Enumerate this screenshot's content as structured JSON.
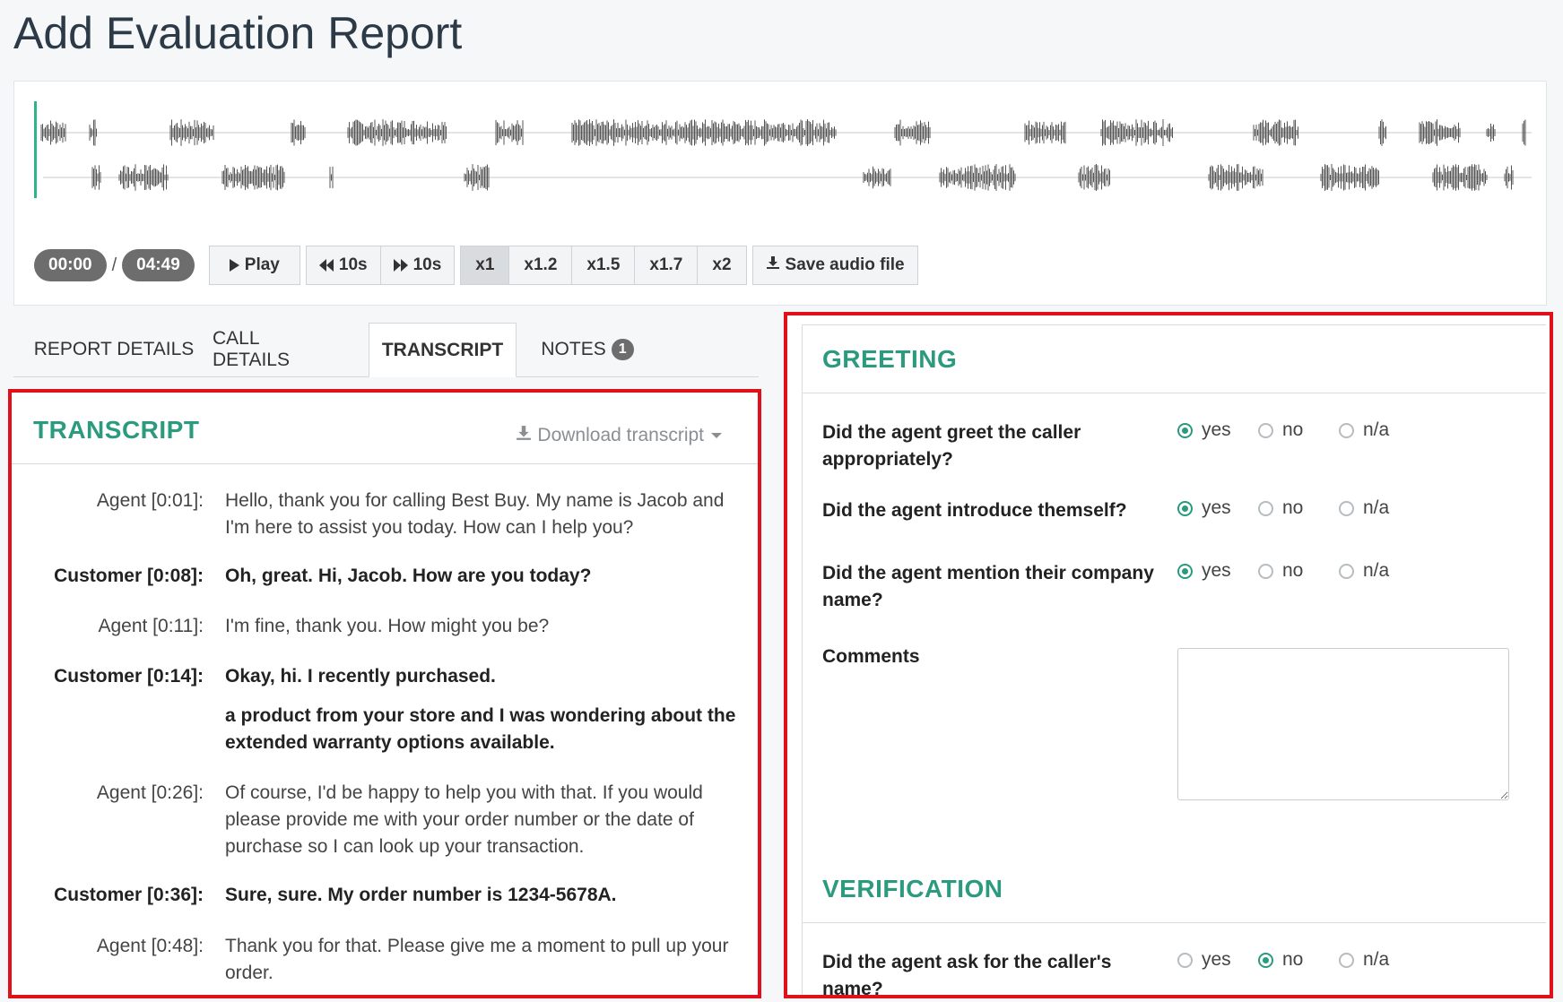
{
  "page": {
    "title": "Add Evaluation Report"
  },
  "player": {
    "current_time": "00:00",
    "time_separator": "/",
    "duration": "04:49",
    "play_label": "Play",
    "rewind_label": "10s",
    "forward_label": "10s",
    "speeds": [
      "x1",
      "x1.2",
      "x1.5",
      "x1.7",
      "x2"
    ],
    "active_speed": "x1",
    "save_label": "Save audio file",
    "accent_color": "#2bb58a"
  },
  "tabs": [
    {
      "label": "REPORT DETAILS"
    },
    {
      "label": "CALL DETAILS"
    },
    {
      "label": "TRANSCRIPT",
      "active": true
    },
    {
      "label": "NOTES",
      "badge": "1"
    }
  ],
  "transcript": {
    "title": "TRANSCRIPT",
    "download_label": "Download transcript",
    "entries": [
      {
        "speaker": "Agent [0:01]:",
        "text": "Hello, thank you for calling Best Buy. My name is Jacob and I'm here to assist you today. How can I help you?"
      },
      {
        "speaker": "Customer [0:08]:",
        "text": "Oh, great. Hi, Jacob. How are you today?"
      },
      {
        "speaker": "Agent [0:11]:",
        "text": "I'm fine, thank you. How might you be?"
      },
      {
        "speaker": "Customer [0:14]:",
        "text": "Okay, hi. I recently purchased."
      },
      {
        "speaker": "",
        "text": "a product from your store and I was wondering about the extended warranty options available."
      },
      {
        "speaker": "Agent [0:26]:",
        "text": "Of course, I'd be happy to help you with that. If you would please provide me with your order number or the date of purchase so I can look up your transaction."
      },
      {
        "speaker": "Customer [0:36]:",
        "text": "Sure, sure. My order number is 1234-5678A."
      },
      {
        "speaker": "Agent [0:48]:",
        "text": "Thank you for that. Please give me a moment to pull up your order."
      }
    ]
  },
  "evaluation": {
    "radio_labels": {
      "yes": "yes",
      "no": "no",
      "na": "n/a"
    },
    "greeting": {
      "title": "GREETING",
      "questions": [
        {
          "label": "Did the agent greet the caller appropriately?",
          "answer": "yes"
        },
        {
          "label": "Did the agent introduce themself?",
          "answer": "yes"
        },
        {
          "label": "Did the agent mention their company name?",
          "answer": "yes"
        }
      ],
      "comments_label": "Comments",
      "comments_value": ""
    },
    "verification": {
      "title": "VERIFICATION",
      "questions": [
        {
          "label": "Did the agent ask for the caller's name?",
          "answer": "no"
        }
      ]
    }
  }
}
